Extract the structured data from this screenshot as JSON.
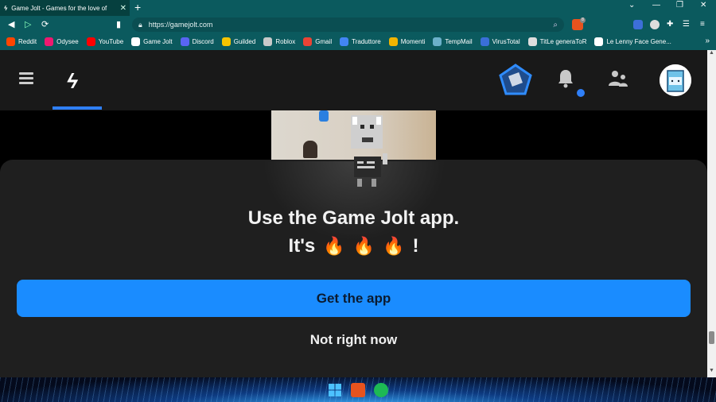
{
  "browser": {
    "tab_title": "Game Jolt - Games for the love of",
    "url": "https://gamejolt.com",
    "brave_badge": "8",
    "bookmarks": [
      {
        "label": "Reddit",
        "color": "#ff4500"
      },
      {
        "label": "Odysee",
        "color": "#ef1970"
      },
      {
        "label": "YouTube",
        "color": "#ff0000"
      },
      {
        "label": "Game Jolt",
        "color": "#ffffff"
      },
      {
        "label": "Discord",
        "color": "#5865f2"
      },
      {
        "label": "Guilded",
        "color": "#f5c400"
      },
      {
        "label": "Roblox",
        "color": "#c9c9c9"
      },
      {
        "label": "Gmail",
        "color": "#ea4335"
      },
      {
        "label": "Traduttore",
        "color": "#4285f4"
      },
      {
        "label": "Momenti",
        "color": "#f2b400"
      },
      {
        "label": "TempMail",
        "color": "#6bb0c9"
      },
      {
        "label": "VirusTotal",
        "color": "#3a6fd8"
      },
      {
        "label": "TitLe generaToR",
        "color": "#dddddd"
      },
      {
        "label": "Le Lenny Face Gene...",
        "color": "#ffffff"
      }
    ]
  },
  "site": {
    "accent": "#2f7ff8",
    "prompt": {
      "title": "Use the Game Jolt app.",
      "subtitle": "It's",
      "flames": [
        "🔥",
        "🔥",
        "🔥"
      ],
      "exclaim": "!",
      "primary_button": "Get the app",
      "secondary_button": "Not right now"
    }
  }
}
